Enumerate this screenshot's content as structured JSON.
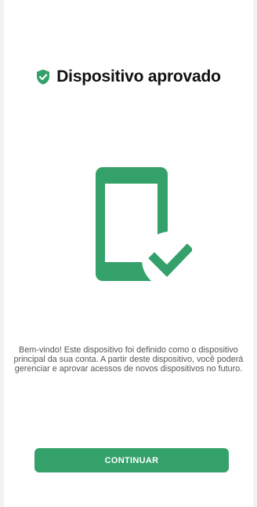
{
  "header": {
    "title": "Dispositivo aprovado",
    "icon": "shield-check-icon"
  },
  "illustration": {
    "icon": "phone-check-icon"
  },
  "message": "Bem-vindo! Este dispositivo foi definido como o dispositivo principal da sua conta. A partir deste dispositivo, você poderá gerenciar e aprovar acessos de novos dispositivos no futuro.",
  "actions": {
    "continue_label": "CONTINUAR"
  },
  "colors": {
    "accent": "#34a06a",
    "title": "#111111",
    "body_text": "#555555",
    "background": "#ffffff"
  }
}
